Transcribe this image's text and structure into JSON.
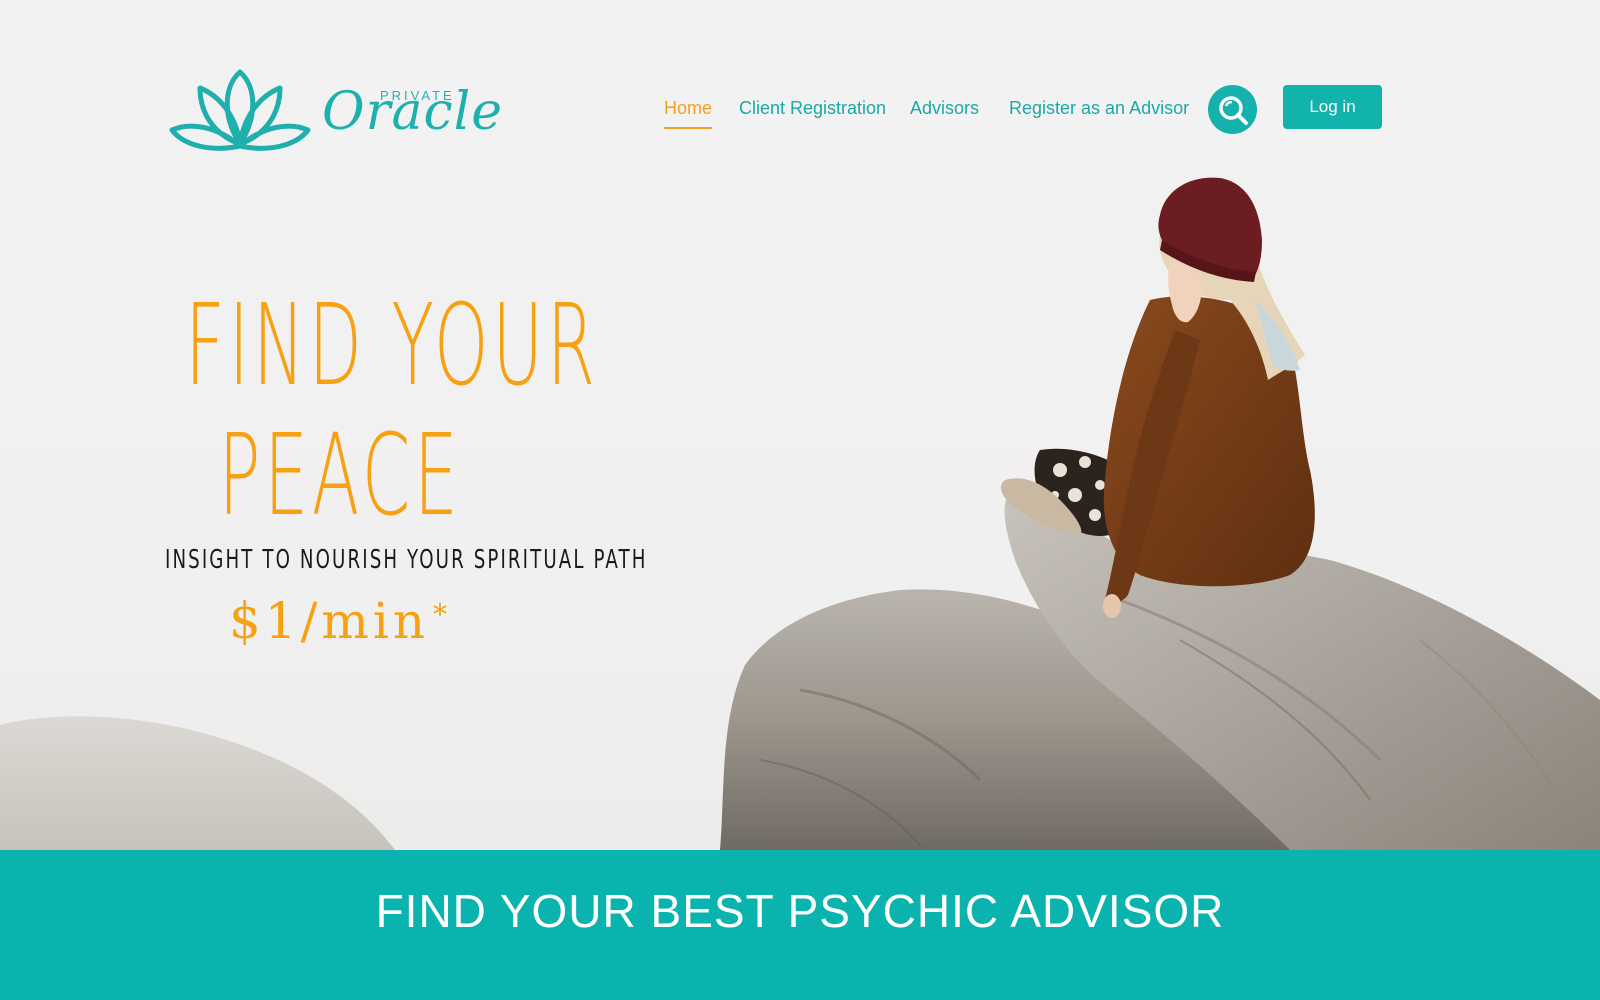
{
  "brand": {
    "small": "PRIVATE",
    "big": "Oracle",
    "logo_icon": "lotus-icon"
  },
  "nav": {
    "items": [
      {
        "label": "Home",
        "active": true
      },
      {
        "label": "Client Registration",
        "active": false
      },
      {
        "label": "Advisors",
        "active": false
      },
      {
        "label": "Register as an Advisor",
        "active": false
      }
    ],
    "search_icon": "search-icon",
    "login_label": "Log in"
  },
  "hero": {
    "line1": "FIND YOUR",
    "line2": "PEACE",
    "tagline": "INSIGHT TO NOURISH YOUR SPIRITUAL PATH",
    "price": "$1/min",
    "price_mark": "*",
    "image": "woman in red beanie sitting on a rock in fog"
  },
  "band": {
    "title": "FIND YOUR BEST PSYCHIC ADVISOR"
  },
  "colors": {
    "teal": "#0ab3ae",
    "orange": "#f6a012",
    "nav_text": "#1aa9a6"
  }
}
